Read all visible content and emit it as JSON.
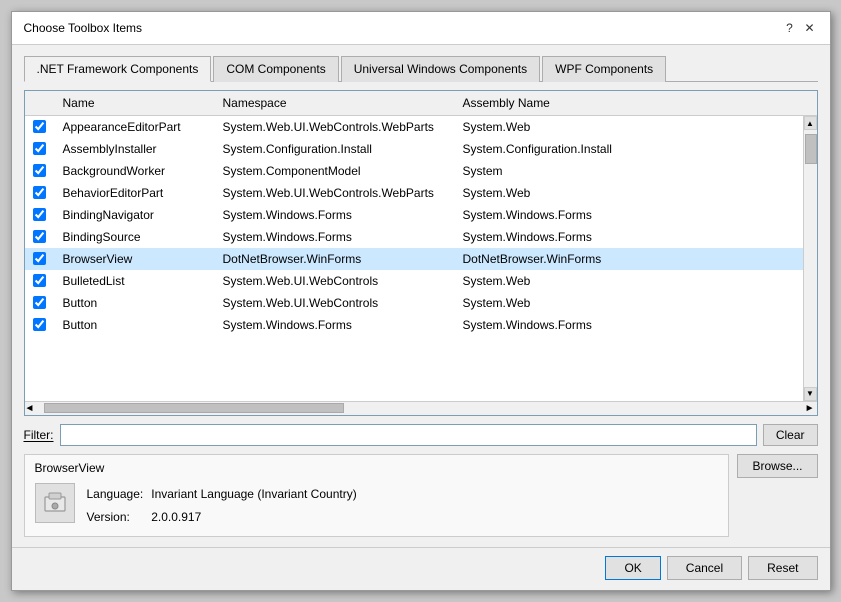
{
  "dialog": {
    "title": "Choose Toolbox Items",
    "help_btn": "?",
    "close_btn": "✕"
  },
  "tabs": [
    {
      "id": "dotnet",
      "label": ".NET Framework Components",
      "active": true
    },
    {
      "id": "com",
      "label": "COM Components",
      "active": false
    },
    {
      "id": "universal",
      "label": "Universal Windows Components",
      "active": false
    },
    {
      "id": "wpf",
      "label": "WPF Components",
      "active": false
    }
  ],
  "table": {
    "columns": [
      "",
      "Name",
      "Namespace",
      "Assembly Name"
    ],
    "rows": [
      {
        "checked": true,
        "name": "AppearanceEditorPart",
        "namespace": "System.Web.UI.WebControls.WebParts",
        "assembly": "System.Web",
        "selected": false
      },
      {
        "checked": true,
        "name": "AssemblyInstaller",
        "namespace": "System.Configuration.Install",
        "assembly": "System.Configuration.Install",
        "selected": false
      },
      {
        "checked": true,
        "name": "BackgroundWorker",
        "namespace": "System.ComponentModel",
        "assembly": "System",
        "selected": false
      },
      {
        "checked": true,
        "name": "BehaviorEditorPart",
        "namespace": "System.Web.UI.WebControls.WebParts",
        "assembly": "System.Web",
        "selected": false
      },
      {
        "checked": true,
        "name": "BindingNavigator",
        "namespace": "System.Windows.Forms",
        "assembly": "System.Windows.Forms",
        "selected": false
      },
      {
        "checked": true,
        "name": "BindingSource",
        "namespace": "System.Windows.Forms",
        "assembly": "System.Windows.Forms",
        "selected": false
      },
      {
        "checked": true,
        "name": "BrowserView",
        "namespace": "DotNetBrowser.WinForms",
        "assembly": "DotNetBrowser.WinForms",
        "selected": true
      },
      {
        "checked": true,
        "name": "BulletedList",
        "namespace": "System.Web.UI.WebControls",
        "assembly": "System.Web",
        "selected": false
      },
      {
        "checked": true,
        "name": "Button",
        "namespace": "System.Web.UI.WebControls",
        "assembly": "System.Web",
        "selected": false
      },
      {
        "checked": true,
        "name": "Button",
        "namespace": "System.Windows.Forms",
        "assembly": "System.Windows.Forms",
        "selected": false
      }
    ]
  },
  "filter": {
    "label": "Filter:",
    "placeholder": "",
    "value": ""
  },
  "clear_btn": "Clear",
  "browse_btn": "Browse...",
  "selected_item": {
    "name": "BrowserView",
    "language_label": "Language:",
    "language_value": "Invariant Language (Invariant Country)",
    "version_label": "Version:",
    "version_value": "2.0.0.917"
  },
  "footer": {
    "ok": "OK",
    "cancel": "Cancel",
    "reset": "Reset"
  }
}
